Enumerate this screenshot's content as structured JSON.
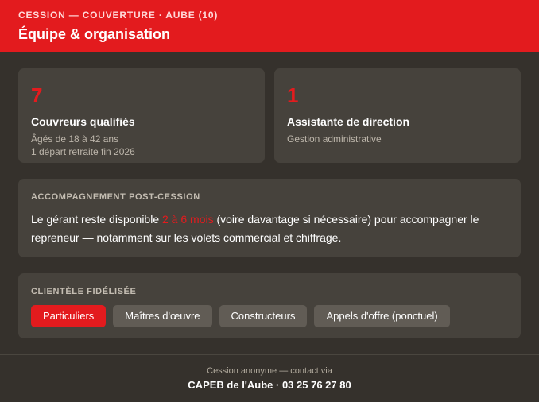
{
  "header": {
    "eyebrow": "CESSION — COUVERTURE · AUBE (10)",
    "title": "Équipe & organisation",
    "accent_color": "#e31b1e"
  },
  "stats": [
    {
      "number": "7",
      "label": "Couvreurs qualifiés",
      "details": [
        "Âgés de 18 à 42 ans",
        "1 départ retraite fin 2026"
      ]
    },
    {
      "number": "1",
      "label": "Assistante de direction",
      "details": [
        "Gestion administrative"
      ]
    }
  ],
  "support": {
    "title": "ACCOMPAGNEMENT POST-CESSION",
    "text_before": "Le gérant reste disponible ",
    "highlight": "2 à 6 mois",
    "text_after": " (voire davantage si nécessaire) pour accompagner le repreneur — notamment sur les volets commercial et chiffrage."
  },
  "clientele": {
    "title": "CLIENTÈLE FIDÉLISÉE",
    "tags": [
      {
        "label": "Particuliers",
        "active": true
      },
      {
        "label": "Maîtres d'œuvre",
        "active": false
      },
      {
        "label": "Constructeurs",
        "active": false
      },
      {
        "label": "Appels d'offre (ponctuel)",
        "active": false
      }
    ]
  },
  "footer": {
    "line1": "Cession anonyme — contact via",
    "line2": "CAPEB de l'Aube · 03 25 76 27 80"
  }
}
